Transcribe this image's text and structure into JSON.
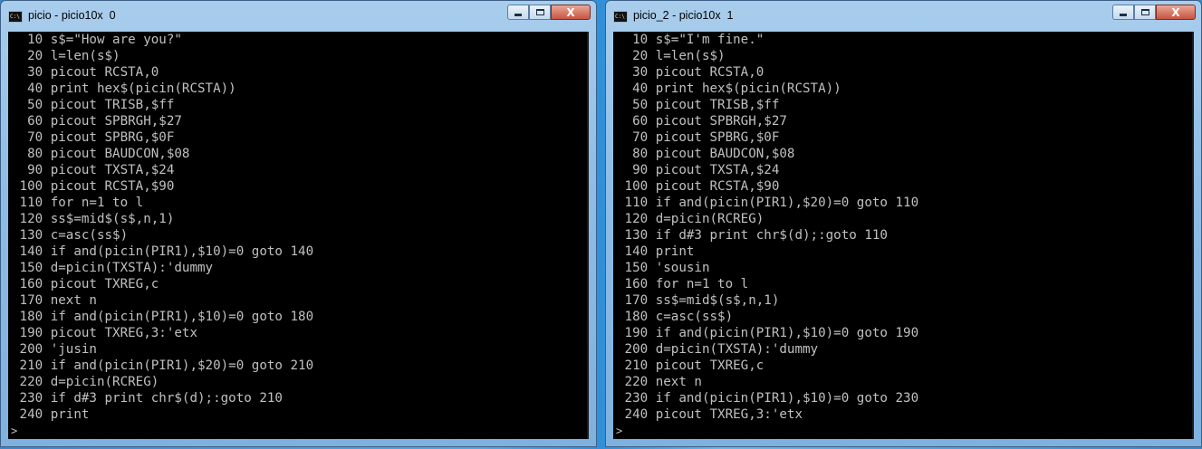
{
  "windows": [
    {
      "title": "picio - picio10x  0",
      "icon": "console-icon",
      "lines": [
        "  10 s$=\"How are you?\"",
        "  20 l=len(s$)",
        "  30 picout RCSTA,0",
        "  40 print hex$(picin(RCSTA))",
        "  50 picout TRISB,$ff",
        "  60 picout SPBRGH,$27",
        "  70 picout SPBRG,$0F",
        "  80 picout BAUDCON,$08",
        "  90 picout TXSTA,$24",
        " 100 picout RCSTA,$90",
        " 110 for n=1 to l",
        " 120 ss$=mid$(s$,n,1)",
        " 130 c=asc(ss$)",
        " 140 if and(picin(PIR1),$10)=0 goto 140",
        " 150 d=picin(TXSTA):'dummy",
        " 160 picout TXREG,c",
        " 170 next n",
        " 180 if and(picin(PIR1),$10)=0 goto 180",
        " 190 picout TXREG,3:'etx",
        " 200 'jusin",
        " 210 if and(picin(PIR1),$20)=0 goto 210",
        " 220 d=picin(RCREG)",
        " 230 if d#3 print chr$(d);:goto 210",
        " 240 print"
      ],
      "prompt": ">"
    },
    {
      "title": "picio_2 - picio10x  1",
      "icon": "console-icon",
      "lines": [
        "  10 s$=\"I'm fine.\"",
        "  20 l=len(s$)",
        "  30 picout RCSTA,0",
        "  40 print hex$(picin(RCSTA))",
        "  50 picout TRISB,$ff",
        "  60 picout SPBRGH,$27",
        "  70 picout SPBRG,$0F",
        "  80 picout BAUDCON,$08",
        "  90 picout TXSTA,$24",
        " 100 picout RCSTA,$90",
        " 110 if and(picin(PIR1),$20)=0 goto 110",
        " 120 d=picin(RCREG)",
        " 130 if d#3 print chr$(d);:goto 110",
        " 140 print",
        " 150 'sousin",
        " 160 for n=1 to l",
        " 170 ss$=mid$(s$,n,1)",
        " 180 c=asc(ss$)",
        " 190 if and(picin(PIR1),$10)=0 goto 190",
        " 200 d=picin(TXSTA):'dummy",
        " 210 picout TXREG,c",
        " 220 next n",
        " 230 if and(picin(PIR1),$10)=0 goto 230",
        " 240 picout TXREG,3:'etx"
      ],
      "prompt": ">"
    }
  ],
  "controls": {
    "close_label": "X"
  },
  "colors": {
    "console_bg": "#000000",
    "console_text": "#c0c0c0",
    "close_button": "#c8553f"
  }
}
